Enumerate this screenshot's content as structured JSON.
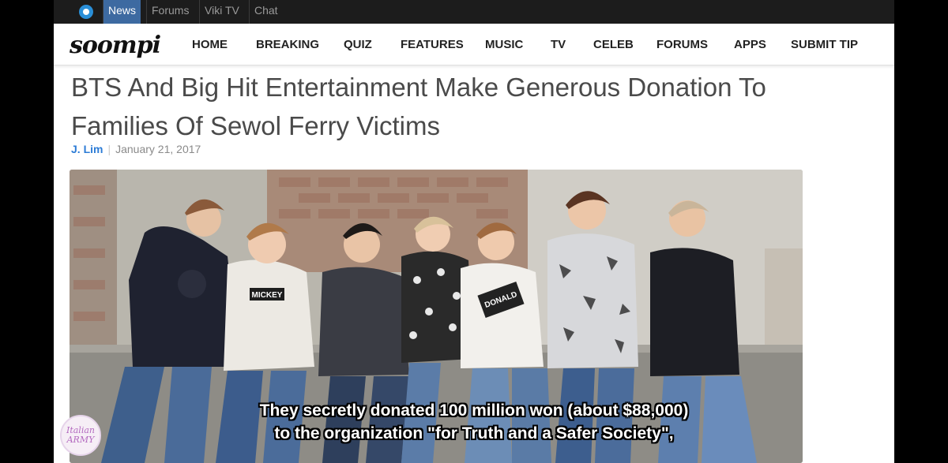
{
  "topbar": {
    "tabs": [
      "News",
      "Forums",
      "Viki TV",
      "Chat"
    ],
    "active_tab": "News"
  },
  "navbar": {
    "brand": "soompi",
    "items": [
      "HOME",
      "BREAKING",
      "QUIZ",
      "FEATURES",
      "MUSIC",
      "TV",
      "CELEB",
      "FORUMS",
      "APPS",
      "SUBMIT TIP"
    ]
  },
  "article": {
    "title": "BTS And Big Hit Entertainment Make Generous Donation To Families Of Sewol Ferry Victims",
    "author": "J. Lim",
    "date": "January 21, 2017",
    "shirt_text_1": "MICKEY",
    "shirt_text_2": "DONALD"
  },
  "subtitles": {
    "line1": "They secretly donated 100 million won (about $88,000)",
    "line2": "to the organization \"for Truth and a Safer Society\","
  },
  "watermark": {
    "line1": "Italian",
    "line2": "ARMY"
  },
  "colors": {
    "topbar_bg": "#1c1c1c",
    "active_tab": "#3d6aa1",
    "author_link": "#2d7cd6",
    "headline": "#4a4a4a"
  }
}
